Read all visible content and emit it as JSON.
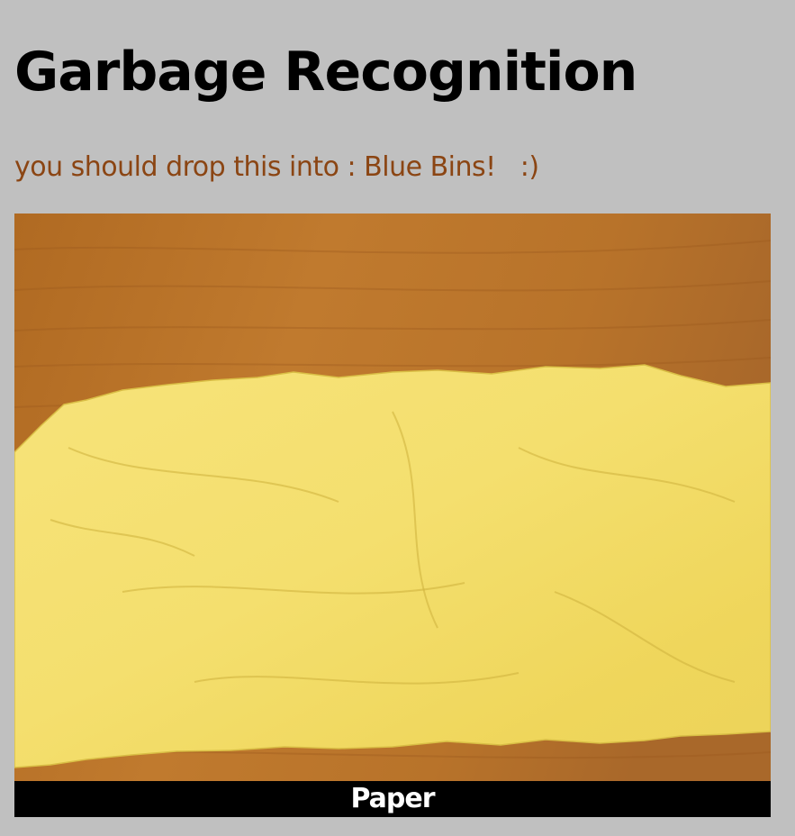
{
  "page": {
    "title": "Garbage Recognition",
    "background_color": "#c0c0c0"
  },
  "result": {
    "message": "you should drop this into : Blue Bins!   :)",
    "message_color": "#8b4513"
  },
  "photo": {
    "subject": "crumpled yellow paper on wooden table",
    "caption": "Paper",
    "caption_bar_color": "#000000",
    "caption_text_color": "#ffffff"
  }
}
